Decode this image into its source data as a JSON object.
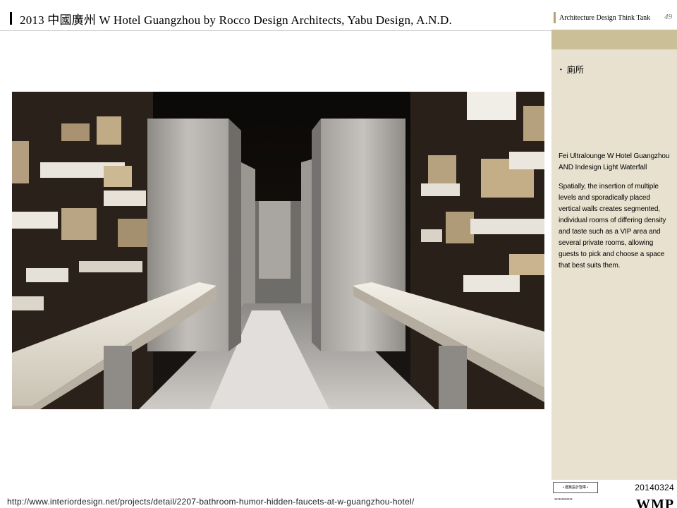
{
  "header": {
    "title": "2013 中國廣州 W Hotel Guangzhou by Rocco Design Architects, Yabu Design, A.N.D."
  },
  "sidebar": {
    "brand": "Architecture Design Think Tank",
    "page_number": "49",
    "bullet": "廁所",
    "caption": "Fei Ultralounge W Hotel Guangzhou AND Indesign Light Waterfall",
    "description": "Spatially, the insertion of multiple levels and sporadically placed vertical walls creates segmented, individual rooms of differing density and taste such as a VIP area and several private rooms, allowing guests to pick and choose a space that best suits them.",
    "date": "20140324",
    "footer_brand": "WMP"
  },
  "source_url": "http://www.interiordesign.net/projects/detail/2207-bathroom-humor-hidden-faucets-at-w-guangzhou-hotel/",
  "colors": {
    "sidebar_bg": "#e8e1cf",
    "sidebar_band": "#cbbf98",
    "accent_mark": "#b5a373"
  }
}
